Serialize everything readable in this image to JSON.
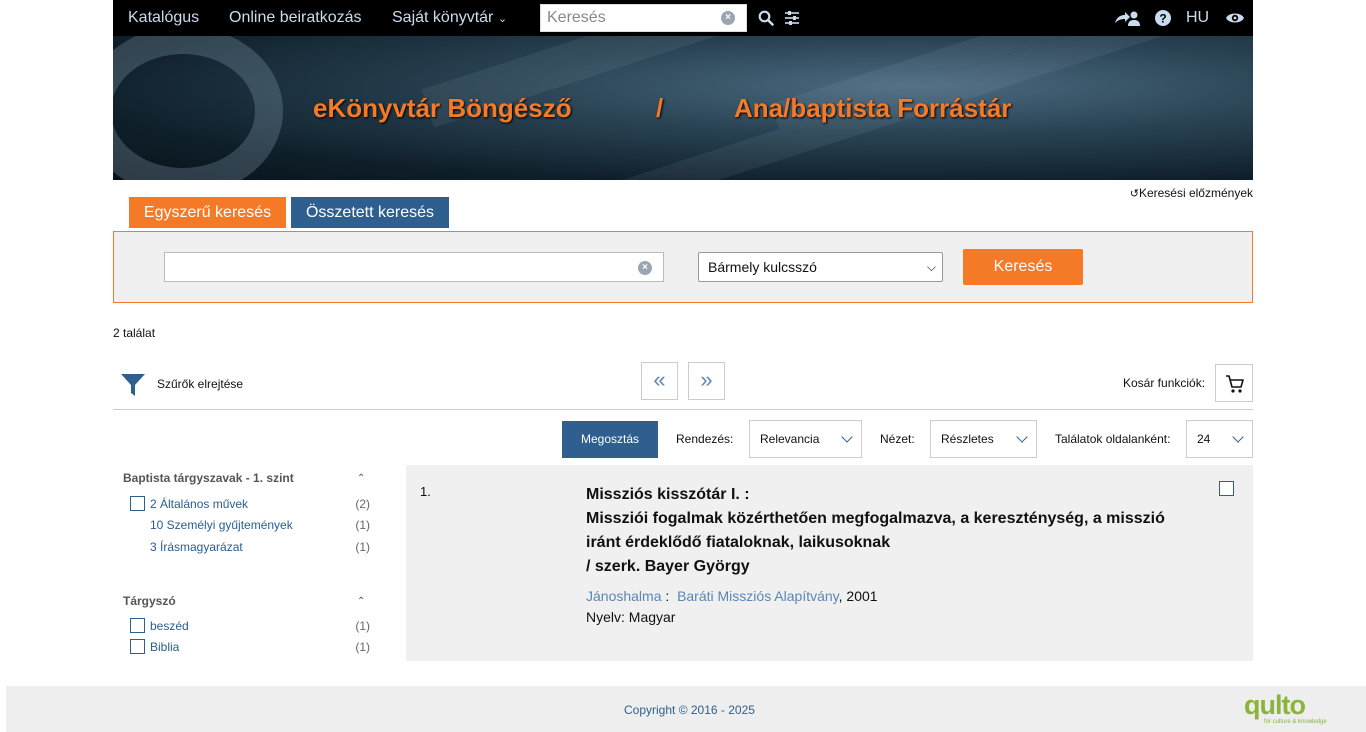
{
  "nav": {
    "catalog": "Katalógus",
    "enroll": "Online beiratkozás",
    "my_library": "Saját könyvtár",
    "search_placeholder": "Keresés",
    "lang": "HU"
  },
  "banner": {
    "left_title": "eKönyvtár Böngésző",
    "separator": "/",
    "right_title": "Ana/baptista Forrástár"
  },
  "history_link": "Keresési előzmények",
  "tabs": {
    "simple": "Egyszerű keresés",
    "advanced": "Összetett keresés"
  },
  "search_panel": {
    "input_value": "",
    "field_select": "Bármely kulcsszó",
    "button": "Keresés"
  },
  "result_count": "2 találat",
  "toolbar": {
    "hide_filters": "Szűrők elrejtése",
    "cart_label": "Kosár funkciók:",
    "share": "Megosztás",
    "sort_label": "Rendezés:",
    "sort_value": "Relevancia",
    "view_label": "Nézet:",
    "view_value": "Részletes",
    "per_page_label": "Találatok oldalanként:",
    "per_page_value": "24"
  },
  "facets": [
    {
      "title": "Baptista tárgyszavak - 1. szint",
      "items": [
        {
          "label": "2 Általános művek",
          "count": "(2)",
          "checkbox": true
        },
        {
          "label": "10 Személyi gyűjtemények",
          "count": "(1)",
          "checkbox": false
        },
        {
          "label": "3 Írásmagyarázat",
          "count": "(1)",
          "checkbox": false
        }
      ]
    },
    {
      "title": "Tárgyszó",
      "items": [
        {
          "label": "beszéd",
          "count": "(1)",
          "checkbox": true
        },
        {
          "label": "Biblia",
          "count": "(1)",
          "checkbox": true
        }
      ]
    }
  ],
  "results": [
    {
      "num": "1.",
      "title_lines": [
        "Missziós kisszótár I. :",
        "Missziói fogalmak közérthetően megfogalmazva, a kereszténység, a misszió",
        "iránt érdeklődő fiataloknak, laikusoknak",
        "/ szerk. Bayer György"
      ],
      "place": "Jánoshalma",
      "publisher": "Baráti Missziós Alapítvány",
      "year": ", 2001",
      "language": "Nyelv: Magyar"
    }
  ],
  "footer": {
    "copyright": "Copyright © 2016 - 2025",
    "logo": "qulto",
    "logo_tagline": "for culture & knowledge"
  },
  "colors": {
    "accent": "#f47a28",
    "primary": "#2f5f8f",
    "link": "#5b86b5"
  }
}
